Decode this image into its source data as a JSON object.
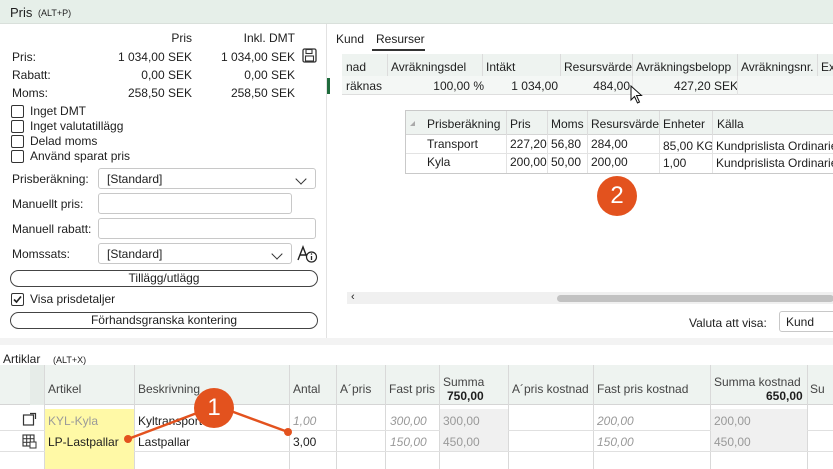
{
  "price_section": {
    "title": "Pris",
    "shortcut": "(ALT+P)"
  },
  "price_table": {
    "col_pris": "Pris",
    "col_inkl": "Inkl. DMT",
    "rows": [
      {
        "label": "Pris:",
        "pris": "1 034,00 SEK",
        "inkl": "1 034,00 SEK"
      },
      {
        "label": "Rabatt:",
        "pris": "0,00 SEK",
        "inkl": "0,00 SEK"
      },
      {
        "label": "Moms:",
        "pris": "258,50 SEK",
        "inkl": "258,50 SEK"
      }
    ]
  },
  "checkboxes": [
    {
      "label": "Inget DMT",
      "checked": false
    },
    {
      "label": "Inget valutatillägg",
      "checked": false
    },
    {
      "label": "Delad moms",
      "checked": false
    },
    {
      "label": "Använd sparat pris",
      "checked": false
    }
  ],
  "form": {
    "prisberakning_label": "Prisberäkning:",
    "prisberakning_value": "[Standard]",
    "manuellt_pris_label": "Manuellt pris:",
    "manuellt_pris_value": "",
    "manuell_rabatt_label": "Manuell rabatt:",
    "manuell_rabatt_value": "",
    "momssats_label": "Momssats:",
    "momssats_value": "[Standard]"
  },
  "buttons": {
    "tillagg": "Tillägg/utlägg",
    "forhandsgranska": "Förhandsgranska kontering"
  },
  "visa_prisdetaljer": {
    "label": "Visa prisdetaljer",
    "checked": true
  },
  "tabs": [
    {
      "label": "Kund",
      "active": false
    },
    {
      "label": "Resurser",
      "active": true
    }
  ],
  "resurser_table": {
    "headers": [
      "nad",
      "Avräkningsdel",
      "Intäkt",
      "Resursvärde",
      "Avräkningsbelopp",
      "Avräkningsnr.",
      "Ex"
    ],
    "row": [
      "räknas",
      "100,00 %",
      "1 034,00",
      "484,00",
      "427,20 SEK",
      "",
      ""
    ]
  },
  "sub_table": {
    "headers": [
      "Prisberäkning",
      "Pris",
      "Moms",
      "Resursvärde",
      "Enheter",
      "Källa"
    ],
    "rows": [
      [
        "Transport",
        "227,20",
        "56,80",
        "284,00",
        "85,00 KG",
        "Kundprislista Ordinarie"
      ],
      [
        "Kyla",
        "200,00",
        "50,00",
        "200,00",
        "1,00",
        "Kundprislista Ordinarie"
      ]
    ]
  },
  "valuta": {
    "label": "Valuta att visa:",
    "value": "Kund"
  },
  "articles_section": {
    "title": "Artiklar",
    "shortcut": "(ALT+X)"
  },
  "articles_table": {
    "headers": {
      "artikel": "Artikel",
      "beskrivning": "Beskrivning",
      "antal": "Antal",
      "apris": "A´pris",
      "fastpris": "Fast pris",
      "summa": "Summa",
      "summa_total": "750,00",
      "apris_kostnad": "A´pris kostnad",
      "fastpris_kostnad": "Fast pris kostnad",
      "summa_kostnad": "Summa kostnad",
      "summa_kostnad_total": "650,00",
      "su": "Su"
    },
    "rows": [
      {
        "artikel": "KYL-Kyla",
        "beskrivning": "Kyltransport",
        "antal": "1,00",
        "apris": "",
        "fastpris": "300,00",
        "summa": "300,00",
        "apris_kostnad": "",
        "fastpris_kostnad": "200,00",
        "summa_kostnad": "200,00"
      },
      {
        "artikel": "LP-Lastpallar",
        "beskrivning": "Lastpallar",
        "antal": "3,00",
        "apris": "",
        "fastpris": "150,00",
        "summa": "450,00",
        "apris_kostnad": "",
        "fastpris_kostnad": "150,00",
        "summa_kostnad": "450,00"
      }
    ]
  },
  "callouts": {
    "one": "1",
    "two": "2"
  },
  "colors": {
    "accent": "#e3521e",
    "header_bg": "#eef3f0",
    "top_bar": "#e6efe9",
    "highlight": "#fff9a6"
  }
}
